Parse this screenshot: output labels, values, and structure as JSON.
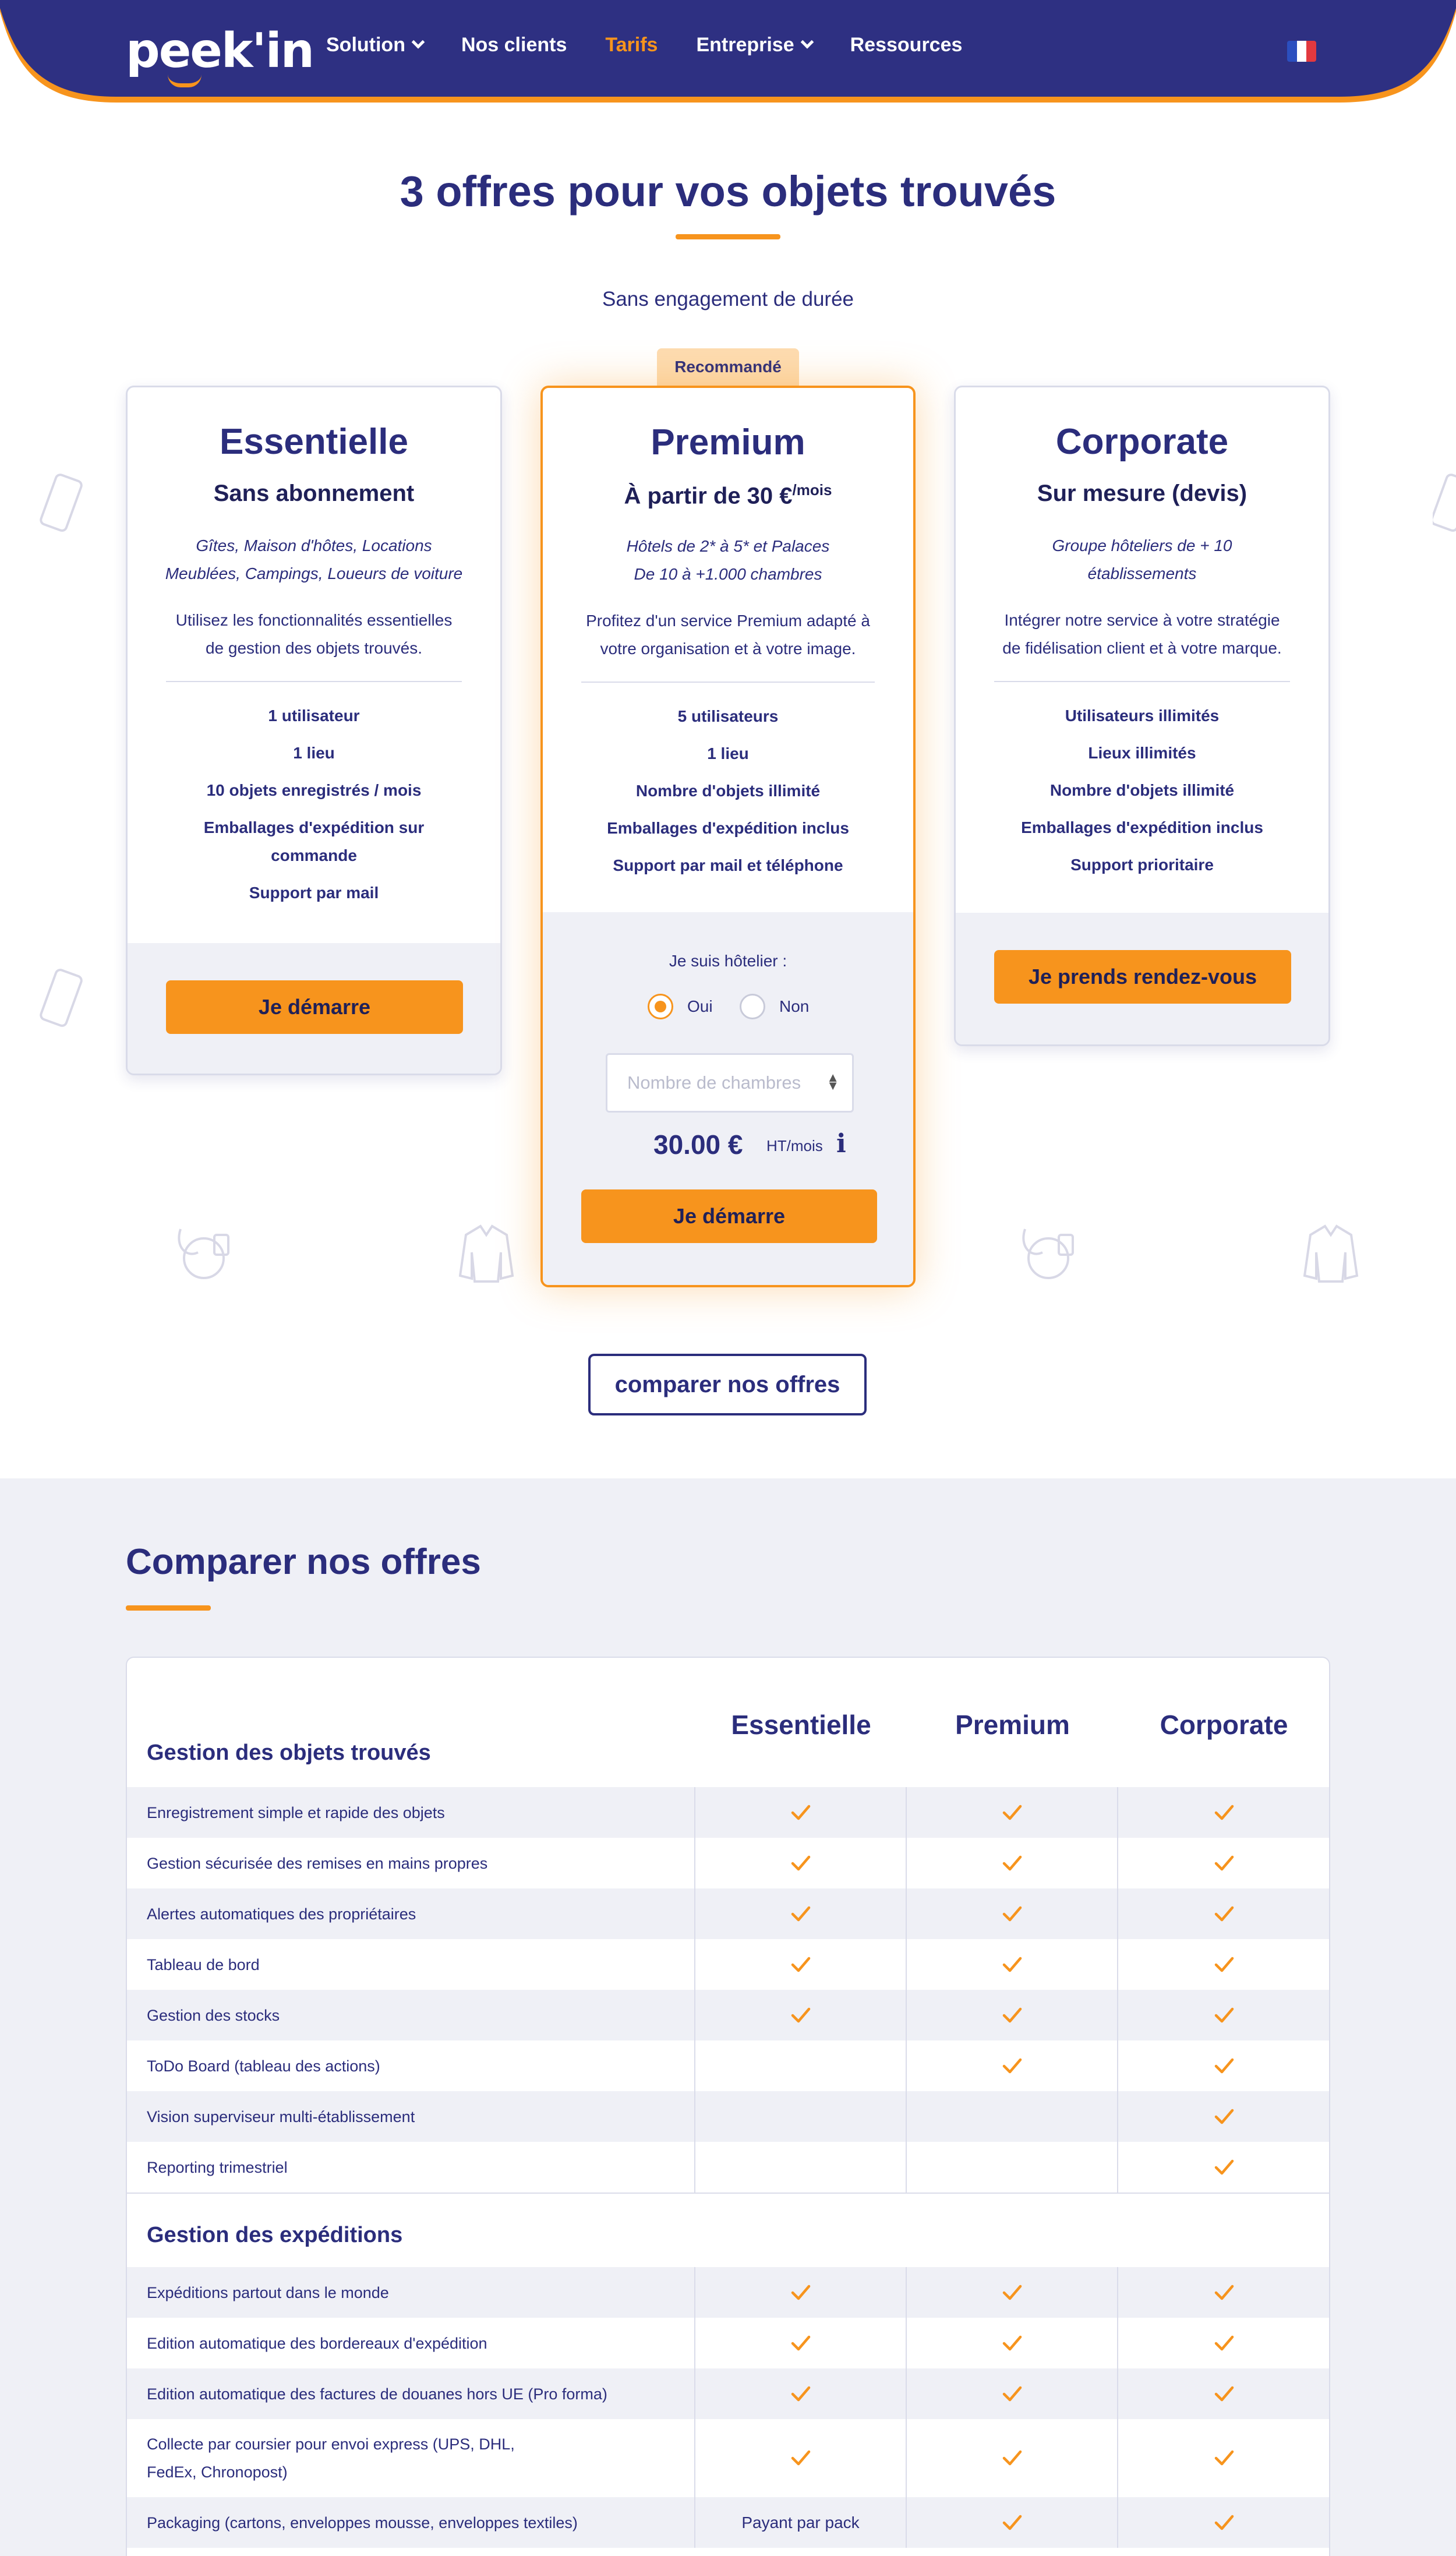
{
  "nav": {
    "logo": "peek'in",
    "items": [
      {
        "label": "Solution",
        "dropdown": true,
        "active": false
      },
      {
        "label": "Nos clients",
        "dropdown": false,
        "active": false
      },
      {
        "label": "Tarifs",
        "dropdown": false,
        "active": true
      },
      {
        "label": "Entreprise",
        "dropdown": true,
        "active": false
      },
      {
        "label": "Ressources",
        "dropdown": false,
        "active": false
      }
    ],
    "language_icon": "flag-fr-icon"
  },
  "hero": {
    "title": "3 offres pour vos objets trouvés",
    "subtitle": "Sans engagement de durée"
  },
  "plans": [
    {
      "name": "Essentielle",
      "subtitle": "Sans abonnement",
      "target": [
        "Gîtes, Maison d'hôtes, Locations",
        "Meublées, Campings, Loueurs de voiture"
      ],
      "description": [
        "Utilisez les fonctionnalités essentielles",
        "de gestion des objets trouvés."
      ],
      "features": [
        "1 utilisateur",
        "1 lieu",
        "10 objets enregistrés / mois",
        "Emballages d'expédition sur commande",
        "Support par mail"
      ],
      "cta": "Je démarre"
    },
    {
      "name": "Premium",
      "badge": "Recommandé",
      "subtitle": "À partir de 30 €",
      "subtitle_unit": "/mois",
      "target": [
        "Hôtels de 2* à 5* et Palaces",
        "De 10 à +1.000 chambres"
      ],
      "description": [
        "Profitez d'un service Premium adapté à",
        "votre organisation et à votre image."
      ],
      "features": [
        "5 utilisateurs",
        "1 lieu",
        "Nombre d'objets illimité",
        "Emballages d'expédition inclus",
        "Support par mail et téléphone"
      ],
      "hotel_question": "Je suis hôtelier :",
      "radio_yes": "Oui",
      "radio_no": "Non",
      "radio_selected": "Oui",
      "rooms_placeholder": "Nombre de chambres",
      "price": "30.00 €",
      "price_unit": "HT/mois",
      "cta": "Je démarre"
    },
    {
      "name": "Corporate",
      "subtitle": "Sur mesure (devis)",
      "target": [
        "Groupe hôteliers de + 10",
        "établissements"
      ],
      "description": [
        "Intégrer notre service à votre stratégie",
        "de fidélisation client et à votre marque."
      ],
      "features": [
        "Utilisateurs illimités",
        "Lieux illimités",
        "Nombre d'objets illimité",
        "Emballages d'expédition inclus",
        "Support prioritaire"
      ],
      "cta": "Je prends rendez-vous"
    }
  ],
  "compare_button": "comparer nos offres",
  "comparison": {
    "title": "Comparer nos offres",
    "columns": [
      "Essentielle",
      "Premium",
      "Corporate"
    ],
    "groups": [
      {
        "title": "Gestion des objets trouvés",
        "rows": [
          {
            "feature": "Enregistrement simple et rapide des objets",
            "cells": [
              true,
              true,
              true
            ]
          },
          {
            "feature": "Gestion sécurisée des remises en mains propres",
            "cells": [
              true,
              true,
              true
            ]
          },
          {
            "feature": "Alertes automatiques des propriétaires",
            "cells": [
              true,
              true,
              true
            ]
          },
          {
            "feature": "Tableau de bord",
            "cells": [
              true,
              true,
              true
            ]
          },
          {
            "feature": "Gestion des stocks",
            "cells": [
              true,
              true,
              true
            ]
          },
          {
            "feature": "ToDo Board (tableau des actions)",
            "cells": [
              false,
              true,
              true
            ]
          },
          {
            "feature": "Vision superviseur multi-établissement",
            "cells": [
              false,
              false,
              true
            ]
          },
          {
            "feature": "Reporting trimestriel",
            "cells": [
              false,
              false,
              true
            ]
          }
        ]
      },
      {
        "title": "Gestion des expéditions",
        "rows": [
          {
            "feature": "Expéditions partout dans le monde",
            "cells": [
              true,
              true,
              true
            ]
          },
          {
            "feature": "Edition automatique des bordereaux d'expédition",
            "cells": [
              true,
              true,
              true
            ]
          },
          {
            "feature": "Edition automatique des factures de douanes hors UE (Pro forma)",
            "cells": [
              true,
              true,
              true
            ]
          },
          {
            "feature": "Collecte par coursier pour envoi express (UPS, DHL, FedEx, Chronopost)",
            "cells": [
              true,
              true,
              true
            ]
          },
          {
            "feature": "Packaging (cartons, enveloppes mousse, enveloppes textiles)",
            "cells": [
              "Payant par pack",
              true,
              true
            ]
          }
        ]
      }
    ]
  },
  "colors": {
    "navy": "#2b2d7c",
    "orange": "#f7941d",
    "light_bg": "#eff0f6"
  }
}
